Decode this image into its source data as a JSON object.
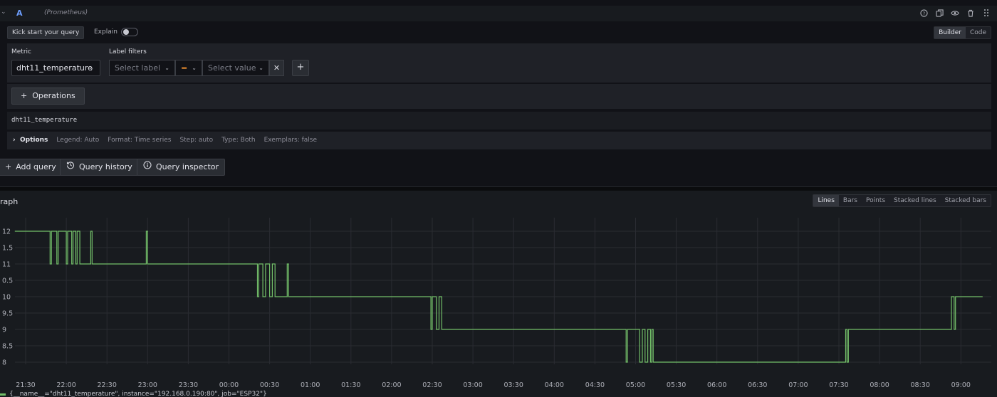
{
  "query": {
    "ref_id": "A",
    "datasource": "(Prometheus)",
    "kick_start_label": "Kick start your query",
    "explain_label": "Explain",
    "mode_builder": "Builder",
    "mode_code": "Code",
    "metric_label": "Metric",
    "metric_value": "dht11_temperature",
    "label_filters_label": "Label filters",
    "select_label_placeholder": "Select label",
    "operator": "=",
    "select_value_placeholder": "Select value",
    "operations_label": "Operations",
    "preview": "dht11_temperature",
    "options_label": "Options",
    "options_meta": [
      "Legend: Auto",
      "Format: Time series",
      "Step: auto",
      "Type: Both",
      "Exemplars: false"
    ]
  },
  "actions": {
    "add_query": "Add query",
    "query_history": "Query history",
    "query_inspector": "Query inspector"
  },
  "graph": {
    "title": "raph",
    "viz_options": [
      "Lines",
      "Bars",
      "Points",
      "Stacked lines",
      "Stacked bars"
    ],
    "active_viz": "Lines",
    "legend_text": "{__name__=\"dht11_temperature\", instance=\"192.168.0.190:80\", job=\"ESP32\"}"
  },
  "colors": {
    "series": "#73bf69",
    "accent": "#6e9fff",
    "operator": "#ff9830"
  },
  "chart_data": {
    "type": "line",
    "y_tick_labels": [
      "12",
      "1.5",
      "11",
      "0.5",
      "10",
      "9.5",
      "9",
      "8.5",
      "8"
    ],
    "y_ticks": [
      12,
      11.5,
      11,
      10.5,
      10,
      9.5,
      9,
      8.5,
      8
    ],
    "ylim": [
      8,
      12
    ],
    "x_ticks": [
      "21:30",
      "22:00",
      "22:30",
      "23:00",
      "23:30",
      "00:00",
      "00:30",
      "01:00",
      "01:30",
      "02:00",
      "02:30",
      "03:00",
      "03:30",
      "04:00",
      "04:30",
      "05:00",
      "05:30",
      "06:00",
      "06:30",
      "07:00",
      "07:30",
      "08:00",
      "08:30",
      "09:00"
    ],
    "grid": true,
    "series": [
      {
        "points": [
          [
            "21:22",
            12
          ],
          [
            "21:48",
            12
          ],
          [
            "21:48",
            11
          ],
          [
            "21:49",
            11
          ],
          [
            "21:49",
            12
          ],
          [
            "21:53",
            12
          ],
          [
            "21:53",
            11
          ],
          [
            "21:54",
            11
          ],
          [
            "21:54",
            12
          ],
          [
            "22:00",
            12
          ],
          [
            "22:00",
            11
          ],
          [
            "22:01",
            11
          ],
          [
            "22:01",
            12
          ],
          [
            "22:04",
            12
          ],
          [
            "22:04",
            11
          ],
          [
            "22:05",
            11
          ],
          [
            "22:05",
            12
          ],
          [
            "22:07",
            12
          ],
          [
            "22:07",
            11
          ],
          [
            "22:08",
            11
          ],
          [
            "22:08",
            12
          ],
          [
            "22:10",
            12
          ],
          [
            "22:10",
            11
          ],
          [
            "22:18",
            11
          ],
          [
            "22:18",
            12
          ],
          [
            "22:19",
            12
          ],
          [
            "22:19",
            11
          ],
          [
            "22:59",
            11
          ],
          [
            "22:59",
            12
          ],
          [
            "23:00",
            12
          ],
          [
            "23:00",
            11
          ],
          [
            "00:21",
            11
          ],
          [
            "00:21",
            10
          ],
          [
            "00:22",
            10
          ],
          [
            "00:22",
            11
          ],
          [
            "00:25",
            11
          ],
          [
            "00:25",
            10
          ],
          [
            "00:27",
            10
          ],
          [
            "00:27",
            11
          ],
          [
            "00:30",
            11
          ],
          [
            "00:30",
            10
          ],
          [
            "00:32",
            10
          ],
          [
            "00:32",
            11
          ],
          [
            "00:34",
            11
          ],
          [
            "00:34",
            10
          ],
          [
            "00:43",
            10
          ],
          [
            "00:43",
            11
          ],
          [
            "00:44",
            11
          ],
          [
            "00:44",
            10
          ],
          [
            "02:29",
            10
          ],
          [
            "02:29",
            9
          ],
          [
            "02:30",
            9
          ],
          [
            "02:30",
            10
          ],
          [
            "02:33",
            10
          ],
          [
            "02:33",
            9
          ],
          [
            "02:35",
            9
          ],
          [
            "02:35",
            10
          ],
          [
            "02:37",
            10
          ],
          [
            "02:37",
            9
          ],
          [
            "04:53",
            9
          ],
          [
            "04:53",
            8
          ],
          [
            "04:54",
            8
          ],
          [
            "04:54",
            9
          ],
          [
            "05:03",
            9
          ],
          [
            "05:03",
            8
          ],
          [
            "05:05",
            8
          ],
          [
            "05:05",
            9
          ],
          [
            "05:07",
            9
          ],
          [
            "05:07",
            8
          ],
          [
            "05:09",
            8
          ],
          [
            "05:09",
            9
          ],
          [
            "05:11",
            9
          ],
          [
            "05:11",
            8
          ],
          [
            "05:12",
            8
          ],
          [
            "05:12",
            9
          ],
          [
            "05:13",
            9
          ],
          [
            "05:13",
            8
          ],
          [
            "07:35",
            8
          ],
          [
            "07:35",
            9
          ],
          [
            "07:36",
            9
          ],
          [
            "07:36",
            8
          ],
          [
            "07:37",
            8
          ],
          [
            "07:37",
            9
          ],
          [
            "08:53",
            9
          ],
          [
            "08:53",
            10
          ],
          [
            "08:55",
            10
          ],
          [
            "08:55",
            9
          ],
          [
            "08:56",
            9
          ],
          [
            "08:56",
            10
          ],
          [
            "09:16",
            10
          ]
        ]
      }
    ]
  }
}
